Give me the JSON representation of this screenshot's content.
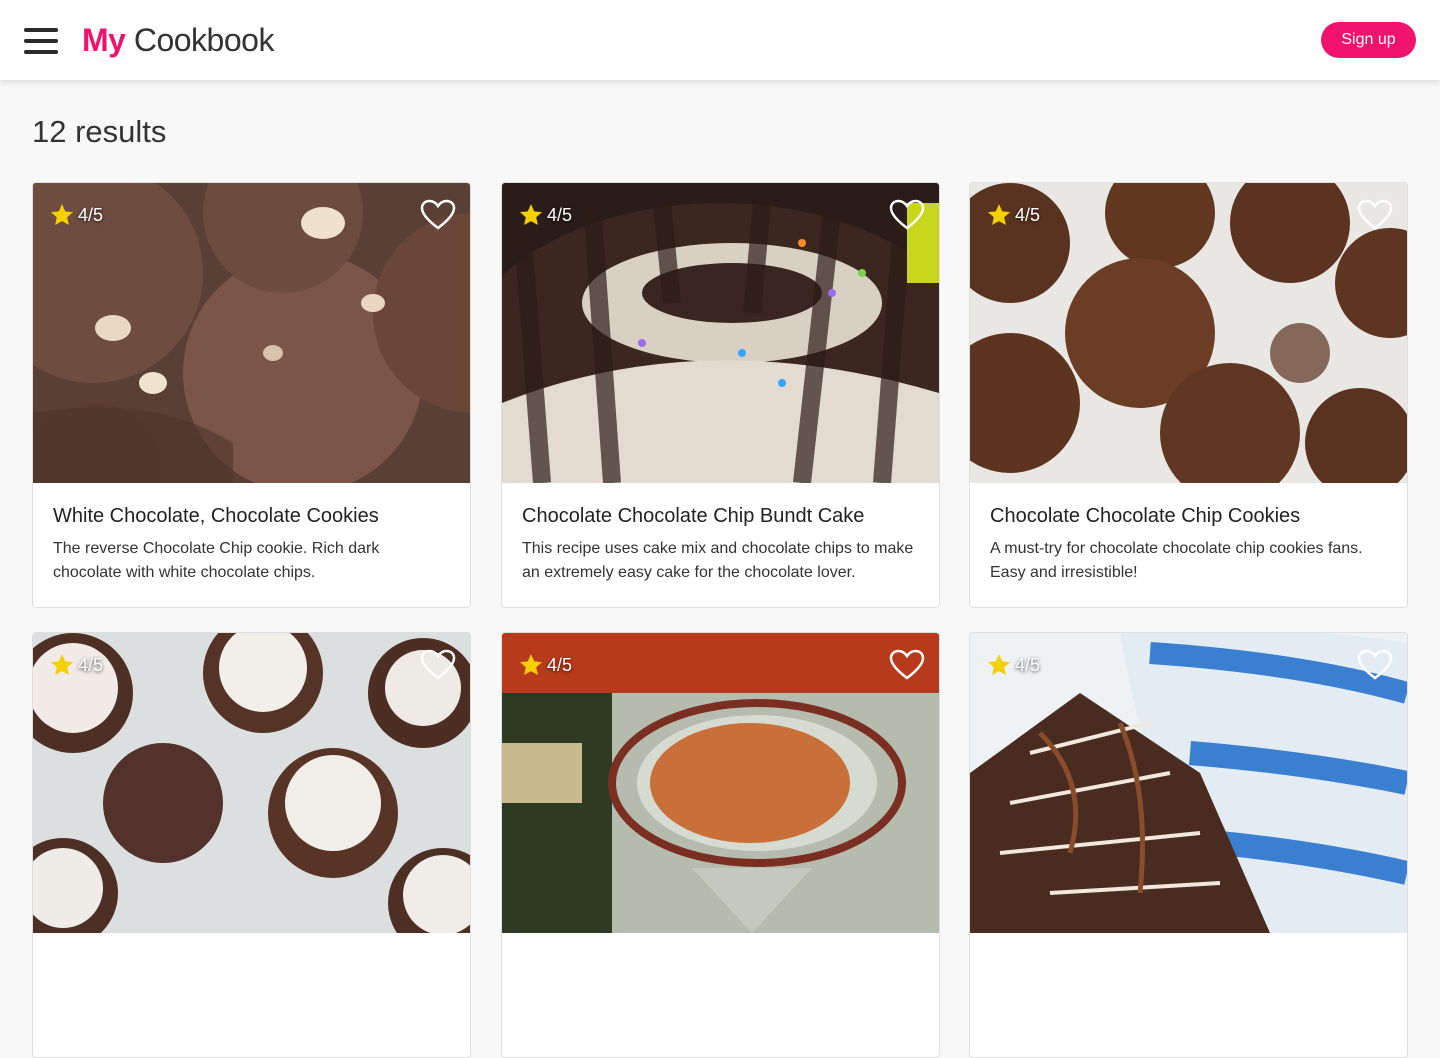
{
  "header": {
    "brand_accent": "My",
    "brand_rest": " Cookbook",
    "signup_label": "Sign up"
  },
  "results_label": "12 results",
  "cards": [
    {
      "rating": "4/5",
      "title": "White Chocolate, Chocolate Cookies",
      "description": "The reverse Chocolate Chip cookie. Rich dark chocolate with white chocolate chips.",
      "image_icon": "recipe-photo"
    },
    {
      "rating": "4/5",
      "title": "Chocolate Chocolate Chip Bundt Cake",
      "description": "This recipe uses cake mix and chocolate chips to make an extremely easy cake for the chocolate lover.",
      "image_icon": "recipe-photo"
    },
    {
      "rating": "4/5",
      "title": "Chocolate Chocolate Chip Cookies",
      "description": "A must-try for chocolate chocolate chip cookies fans. Easy and irresistible!",
      "image_icon": "recipe-photo"
    },
    {
      "rating": "4/5",
      "title": "",
      "description": "",
      "image_icon": "recipe-photo"
    },
    {
      "rating": "4/5",
      "title": "",
      "description": "",
      "image_icon": "recipe-photo"
    },
    {
      "rating": "4/5",
      "title": "",
      "description": "",
      "image_icon": "recipe-photo"
    }
  ],
  "colors": {
    "accent": "#f0136d",
    "star": "#f5d000",
    "background": "#f8f8f8"
  },
  "icons": [
    "hamburger-menu-icon",
    "star-icon",
    "heart-outline-icon"
  ]
}
